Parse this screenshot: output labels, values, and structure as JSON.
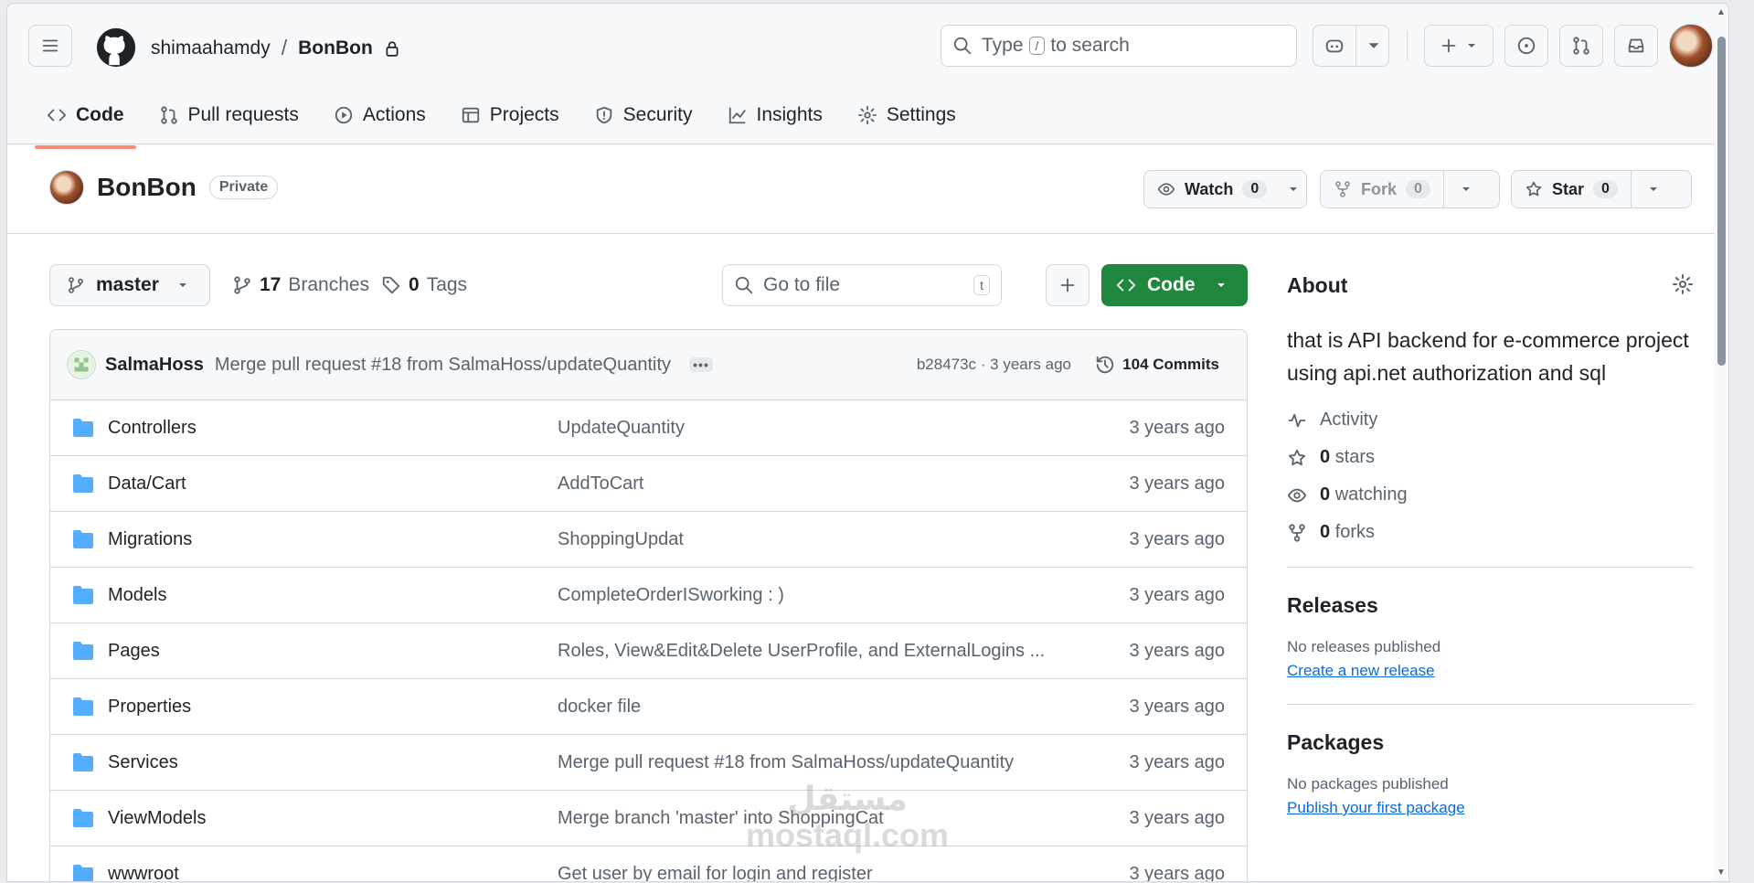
{
  "header": {
    "owner": "shimaahamdy",
    "separator": "/",
    "repo": "BonBon",
    "search_prefix": "Type",
    "search_key": "/",
    "search_suffix": "to search",
    "tabs": [
      {
        "label": "Code",
        "icon": "code-icon"
      },
      {
        "label": "Pull requests",
        "icon": "pull-request-icon"
      },
      {
        "label": "Actions",
        "icon": "play-icon"
      },
      {
        "label": "Projects",
        "icon": "table-icon"
      },
      {
        "label": "Security",
        "icon": "shield-icon"
      },
      {
        "label": "Insights",
        "icon": "graph-icon"
      },
      {
        "label": "Settings",
        "icon": "gear-icon"
      }
    ]
  },
  "repo_head": {
    "name": "BonBon",
    "visibility": "Private",
    "watch_label": "Watch",
    "watch_count": "0",
    "fork_label": "Fork",
    "fork_count": "0",
    "star_label": "Star",
    "star_count": "0"
  },
  "toolbar": {
    "branch": "master",
    "branches_count": "17",
    "branches_label": "Branches",
    "tags_count": "0",
    "tags_label": "Tags",
    "goto_placeholder": "Go to file",
    "goto_key": "t",
    "code_label": "Code"
  },
  "commit": {
    "author": "SalmaHoss",
    "message": "Merge pull request #18 from SalmaHoss/updateQuantity",
    "sha_time": "b28473c · 3 years ago",
    "commits": "104 Commits"
  },
  "files": [
    {
      "name": "Controllers",
      "message": "UpdateQuantity",
      "date": "3 years ago"
    },
    {
      "name": "Data/Cart",
      "message": "AddToCart",
      "date": "3 years ago"
    },
    {
      "name": "Migrations",
      "message": "ShoppingUpdat",
      "date": "3 years ago"
    },
    {
      "name": "Models",
      "message": "CompleteOrderISworking : )",
      "date": "3 years ago"
    },
    {
      "name": "Pages",
      "message": "Roles, View&Edit&Delete UserProfile, and ExternalLogins ...",
      "date": "3 years ago"
    },
    {
      "name": "Properties",
      "message": "docker file",
      "date": "3 years ago"
    },
    {
      "name": "Services",
      "message": "Merge pull request #18 from SalmaHoss/updateQuantity",
      "date": "3 years ago"
    },
    {
      "name": "ViewModels",
      "message": "Merge branch 'master' into ShoppingCat",
      "date": "3 years ago"
    },
    {
      "name": "wwwroot",
      "message": "Get user by email for login and register",
      "date": "3 years ago"
    }
  ],
  "about": {
    "title": "About",
    "description": "that is API backend for e-commerce project using api.net authorization and sql",
    "activity": "Activity",
    "stars_count": "0",
    "stars_label": "stars",
    "watching_count": "0",
    "watching_label": "watching",
    "forks_count": "0",
    "forks_label": "forks"
  },
  "releases": {
    "title": "Releases",
    "empty": "No releases published",
    "link": "Create a new release"
  },
  "packages": {
    "title": "Packages",
    "empty": "No packages published",
    "link": "Publish your first package"
  },
  "watermark": {
    "line1": "مستقل",
    "line2": "mostaql.com"
  }
}
